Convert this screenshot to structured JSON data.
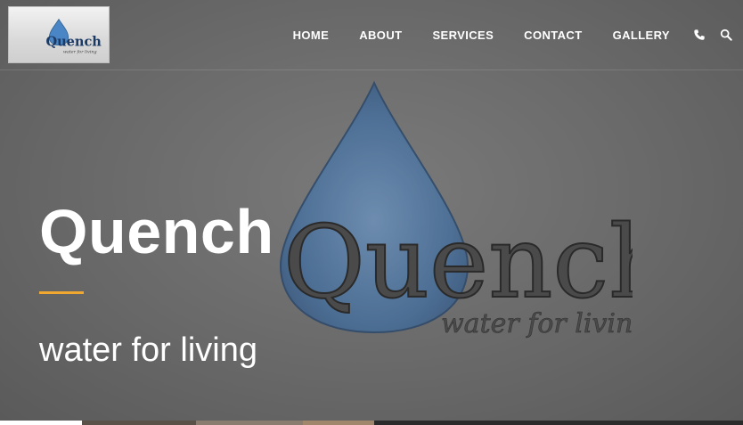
{
  "brand": {
    "logo_text": "Quench",
    "logo_subtext": "water for living"
  },
  "nav": {
    "items": [
      {
        "label": "HOME"
      },
      {
        "label": "ABOUT"
      },
      {
        "label": "SERVICES"
      },
      {
        "label": "CONTACT"
      },
      {
        "label": "GALLERY"
      }
    ],
    "icons": [
      "phone-icon",
      "search-icon"
    ]
  },
  "hero": {
    "title": "Quench",
    "tagline": "water for living",
    "logo_text": "Quench",
    "logo_subtext": "water for living"
  },
  "colors": {
    "accent": "#f0a830",
    "drop_blue": "#4a6f99",
    "text_white": "#ffffff"
  }
}
